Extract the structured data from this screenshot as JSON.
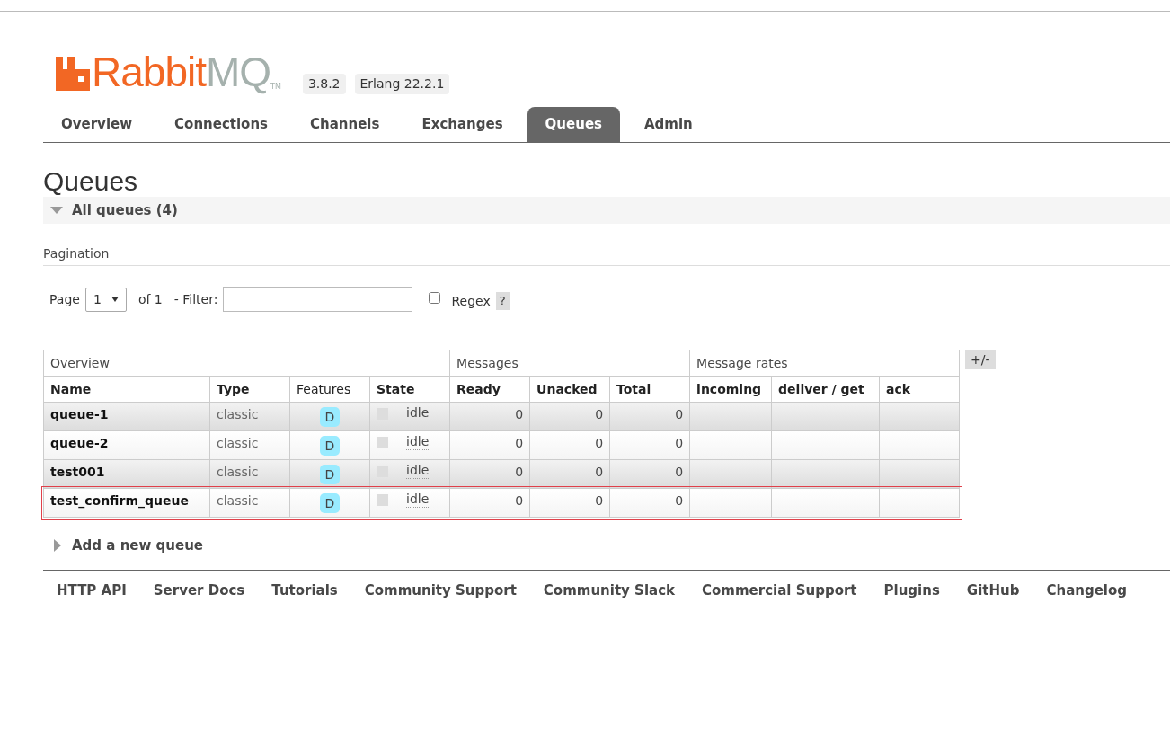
{
  "header": {
    "logo": {
      "part1": "Rabbit",
      "part2": "MQ",
      "tm": "TM"
    },
    "version": "3.8.2",
    "erlang": "Erlang 22.2.1"
  },
  "tabs": [
    {
      "label": "Overview",
      "selected": false
    },
    {
      "label": "Connections",
      "selected": false
    },
    {
      "label": "Channels",
      "selected": false
    },
    {
      "label": "Exchanges",
      "selected": false
    },
    {
      "label": "Queues",
      "selected": true
    },
    {
      "label": "Admin",
      "selected": false
    }
  ],
  "page_title": "Queues",
  "sections": [
    {
      "label": "All queues (4)",
      "expanded": true
    },
    {
      "label": "Add a new queue",
      "expanded": false
    }
  ],
  "pagination": {
    "heading": "Pagination",
    "page_label": "Page",
    "page_value": "1",
    "of_label": "of 1",
    "filter_label": "- Filter:",
    "regex_label": "Regex",
    "regex_checked": false,
    "help": "?"
  },
  "table": {
    "groups": [
      {
        "label": "Overview"
      },
      {
        "label": "Messages"
      },
      {
        "label": "Message rates"
      }
    ],
    "columns": [
      {
        "label": "Name",
        "bold": true
      },
      {
        "label": "Type",
        "bold": true
      },
      {
        "label": "Features",
        "bold": false
      },
      {
        "label": "State",
        "bold": true
      },
      {
        "label": "Ready",
        "bold": true
      },
      {
        "label": "Unacked",
        "bold": true
      },
      {
        "label": "Total",
        "bold": true
      },
      {
        "label": "incoming",
        "bold": true
      },
      {
        "label": "deliver / get",
        "bold": true
      },
      {
        "label": "ack",
        "bold": true
      }
    ],
    "toggle": "+/-",
    "rows": [
      {
        "name": "queue-1",
        "type": "classic",
        "feature": "D",
        "state": "idle",
        "ready": "0",
        "unacked": "0",
        "total": "0",
        "highlighted": false
      },
      {
        "name": "queue-2",
        "type": "classic",
        "feature": "D",
        "state": "idle",
        "ready": "0",
        "unacked": "0",
        "total": "0",
        "highlighted": false
      },
      {
        "name": "test001",
        "type": "classic",
        "feature": "D",
        "state": "idle",
        "ready": "0",
        "unacked": "0",
        "total": "0",
        "highlighted": false
      },
      {
        "name": "test_confirm_queue",
        "type": "classic",
        "feature": "D",
        "state": "idle",
        "ready": "0",
        "unacked": "0",
        "total": "0",
        "highlighted": true
      }
    ]
  },
  "footer": [
    "HTTP API",
    "Server Docs",
    "Tutorials",
    "Community Support",
    "Community Slack",
    "Commercial Support",
    "Plugins",
    "GitHub",
    "Changelog"
  ]
}
